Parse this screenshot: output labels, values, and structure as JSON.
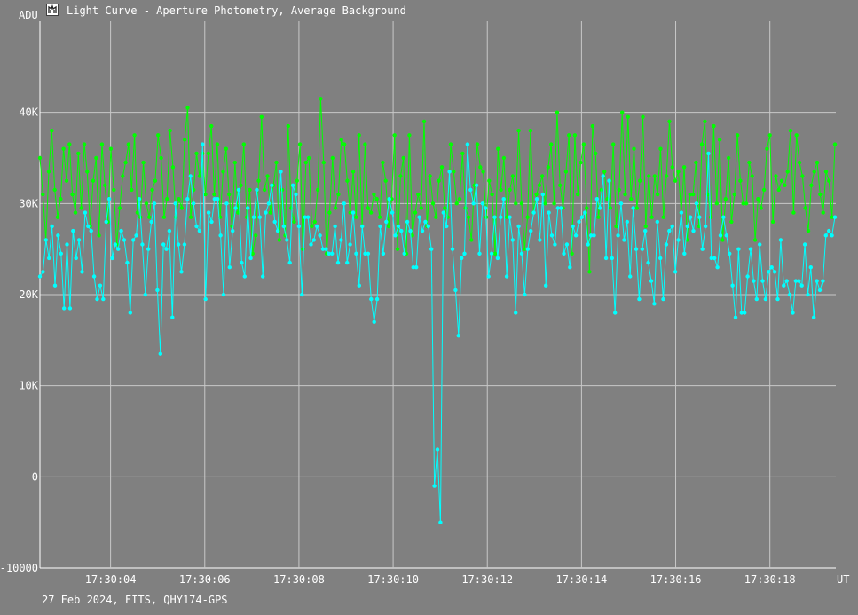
{
  "window": {
    "title": "Light Curve - Aperture Photometry, Average Background"
  },
  "footer": {
    "text": "27 Feb 2024, FITS, QHY174-GPS"
  },
  "colors": {
    "background": "#808080",
    "grid": "#c8c8c8",
    "series_green": "#00ff00",
    "series_cyan": "#00ffff"
  },
  "chart_data": {
    "type": "line",
    "ylabel": "ADU",
    "xlabel": "UT",
    "ylim": [
      -10000,
      50000
    ],
    "xlim": [
      "17:30:02.500",
      "17:30:19.400"
    ],
    "yticks": [
      {
        "value": 40000,
        "label": "40K"
      },
      {
        "value": 30000,
        "label": "30K"
      },
      {
        "value": 20000,
        "label": "20K"
      },
      {
        "value": 10000,
        "label": "10K"
      },
      {
        "value": 0,
        "label": "0"
      },
      {
        "value": -10000,
        "label": "-10000"
      }
    ],
    "xticks": [
      "17:30:04",
      "17:30:06",
      "17:30:08",
      "17:30:10",
      "17:30:12",
      "17:30:14",
      "17:30:16",
      "17:30:18"
    ],
    "grid": true,
    "series": [
      {
        "color": "#00ff00",
        "values": [
          35000,
          31000,
          26000,
          33500,
          38000,
          31500,
          28500,
          30500,
          36000,
          32500,
          36500,
          31000,
          29000,
          35500,
          29500,
          36500,
          33500,
          27500,
          32500,
          35000,
          26500,
          36500,
          32000,
          28000,
          36000,
          31500,
          25500,
          29500,
          33000,
          34500,
          36500,
          31500,
          37500,
          29000,
          28500,
          34500,
          30000,
          28500,
          31500,
          32500,
          37500,
          35000,
          28500,
          30500,
          38000,
          34000,
          28500,
          30500,
          29500,
          37000,
          40500,
          28500,
          31500,
          35500,
          33000,
          35500,
          31000,
          35500,
          38500,
          31000,
          36500,
          28500,
          33500,
          36000,
          31000,
          27500,
          34500,
          29000,
          32000,
          36500,
          28500,
          31500,
          24500,
          26500,
          32500,
          39500,
          31500,
          33000,
          29000,
          32000,
          34500,
          26000,
          31500,
          26500,
          38500,
          29500,
          28000,
          32500,
          36500,
          25000,
          34500,
          35000,
          27500,
          28000,
          31500,
          41500,
          34500,
          24500,
          29000,
          35000,
          29500,
          31000,
          37000,
          36500,
          32500,
          29000,
          33500,
          28500,
          37500,
          27500,
          36500,
          29500,
          29000,
          31000,
          30500,
          28500,
          34500,
          32500,
          27500,
          30500,
          37500,
          25000,
          33000,
          35000,
          24500,
          37500,
          26500,
          29000,
          31000,
          29500,
          39000,
          27500,
          33000,
          30000,
          28500,
          32500,
          34000,
          29500,
          28500,
          36500,
          33500,
          30000,
          30500,
          35500,
          29500,
          28500,
          26000,
          32000,
          36500,
          34000,
          33500,
          28500,
          32500,
          31000,
          24500,
          36000,
          31500,
          35000,
          28500,
          31500,
          33000,
          30000,
          38000,
          30000,
          25000,
          28500,
          38000,
          29000,
          31000,
          32000,
          33000,
          30000,
          34000,
          36500,
          30000,
          40000,
          32000,
          29500,
          33500,
          37500,
          24500,
          37500,
          31000,
          34500,
          36500,
          29500,
          22500,
          38500,
          35500,
          28500,
          31500,
          33500,
          30500,
          29500,
          36500,
          27500,
          31500,
          40000,
          31000,
          39500,
          30500,
          36000,
          29500,
          32500,
          39500,
          27500,
          33000,
          28500,
          33000,
          31000,
          36000,
          28500,
          33000,
          39000,
          34000,
          32500,
          33500,
          29000,
          34000,
          26000,
          31000,
          31000,
          34500,
          27500,
          36500,
          39000,
          31000,
          28500,
          38500,
          30000,
          37000,
          26000,
          30500,
          35000,
          28000,
          31000,
          37500,
          32500,
          30000,
          30000,
          34500,
          33000,
          26000,
          30500,
          29500,
          31500,
          36000,
          37500,
          28000,
          33000,
          31500,
          32500,
          32000,
          33500,
          38000,
          29000,
          37500,
          34500,
          33000,
          29500,
          27000,
          32000,
          33500,
          34500,
          31000,
          29000,
          33500,
          32500,
          28500,
          36500
        ]
      },
      {
        "color": "#00ffff",
        "values": [
          22000,
          22500,
          26000,
          24000,
          27500,
          21000,
          26500,
          24500,
          18500,
          25500,
          18500,
          27000,
          24000,
          26000,
          22500,
          29000,
          27500,
          27000,
          22000,
          19500,
          21000,
          19500,
          28000,
          30500,
          24000,
          25500,
          25000,
          27000,
          26000,
          23500,
          18000,
          26000,
          26500,
          30500,
          25500,
          20000,
          25000,
          28000,
          30000,
          20500,
          13500,
          25500,
          25000,
          27000,
          17500,
          30000,
          25500,
          22500,
          25500,
          30500,
          33000,
          30000,
          27500,
          27000,
          36500,
          19500,
          29000,
          28000,
          30500,
          30500,
          26500,
          20000,
          30000,
          23000,
          27000,
          29500,
          31500,
          23500,
          22000,
          29500,
          24000,
          28500,
          31500,
          28500,
          22000,
          29000,
          30000,
          32000,
          28000,
          27000,
          33500,
          27500,
          26000,
          23500,
          32000,
          31000,
          27500,
          20000,
          28500,
          28500,
          25500,
          26000,
          27500,
          26500,
          25000,
          25000,
          24500,
          24500,
          27500,
          23500,
          26000,
          30000,
          23500,
          25500,
          29000,
          24500,
          21000,
          27500,
          24500,
          24500,
          19500,
          17000,
          19500,
          27500,
          24500,
          28000,
          30500,
          29000,
          26500,
          27500,
          27000,
          24500,
          28000,
          27000,
          23000,
          23000,
          28500,
          27000,
          28000,
          27500,
          25000,
          -1000,
          3000,
          -5000,
          29000,
          27500,
          33500,
          25000,
          20500,
          15500,
          24000,
          24500,
          36500,
          31500,
          30000,
          32000,
          24500,
          30000,
          29500,
          22000,
          24500,
          28500,
          24000,
          28500,
          30500,
          22000,
          28500,
          26000,
          18000,
          27500,
          24500,
          20000,
          25000,
          27000,
          29000,
          30500,
          26000,
          31000,
          21000,
          29000,
          26500,
          25500,
          29500,
          29500,
          24500,
          25500,
          23000,
          27500,
          26500,
          28000,
          28500,
          29000,
          25500,
          26500,
          26500,
          30500,
          29500,
          33000,
          24000,
          32500,
          24000,
          18000,
          26500,
          30000,
          26000,
          28000,
          22000,
          29500,
          25000,
          19500,
          25000,
          27000,
          23500,
          21500,
          19000,
          28000,
          24000,
          19500,
          25500,
          27000,
          27500,
          22500,
          26000,
          29000,
          24500,
          27500,
          28500,
          27000,
          30000,
          28500,
          25000,
          27500,
          35500,
          24000,
          24000,
          23000,
          26500,
          28500,
          26500,
          24500,
          21000,
          17500,
          25000,
          18000,
          18000,
          22000,
          25000,
          21500,
          19500,
          25500,
          21500,
          19500,
          22500,
          23000,
          22500,
          19500,
          26000,
          21000,
          21500,
          20000,
          18000,
          21500,
          21500,
          21000,
          25500,
          20000,
          23000,
          17500,
          21500,
          20500,
          21500,
          26500,
          27000,
          26500,
          28500
        ]
      }
    ]
  }
}
